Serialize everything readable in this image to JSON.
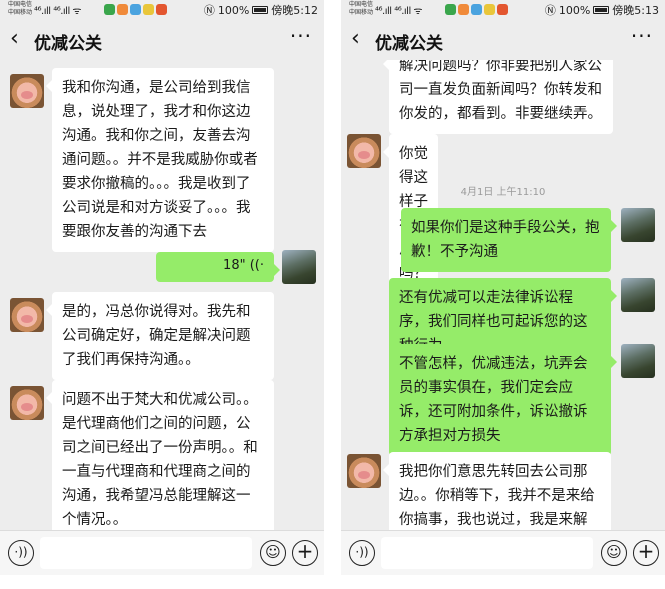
{
  "colors": {
    "chat_background": "#ededed",
    "bubble_incoming": "#ffffff",
    "bubble_outgoing": "#95ec69",
    "timestamp_text": "#9a9a9a"
  },
  "screens": [
    {
      "status": {
        "carrier_1": "中国电信",
        "carrier_2": "中国移动",
        "signal": "⁴⁶.ıll ⁴⁶.ıll ᯤ",
        "battery": "100%",
        "time": "傍晚5:12"
      },
      "header": {
        "back_icon": "chevron-left-icon",
        "title": "优减公关",
        "more": "···"
      },
      "messages": [
        {
          "side": "in",
          "text": "我和你沟通，是公司给到我信息，说处理了，我才和你这边沟通。我和你之间，友善去沟通问题。。并不是我威胁你或者要求你撤稿的。。。我是收到了公司说是和对方谈妥了。。。我要跟你友善的沟通下去"
        },
        {
          "side": "out",
          "kind": "voice",
          "duration": "18\"",
          "icon": "voice-wave-icon"
        },
        {
          "side": "in",
          "text": "是的，冯总你说得对。我先和公司确定好，确定是解决问题了我们再保持沟通。。"
        },
        {
          "side": "in",
          "text": "问题不出于梵大和优减公司。。是代理商他们之间的问题，公司之间已经出了一份声明。。和一直与代理商和代理商之间的沟通，我希望冯总能理解这一个情况。。"
        }
      ],
      "input": {
        "voice_icon": "voice-mode-icon",
        "emoji_icon": "emoji-icon",
        "plus_icon": "plus-icon"
      }
    },
    {
      "status": {
        "carrier_1": "中国电信",
        "carrier_2": "中国移动",
        "signal": "⁴⁶.ıll ⁴⁶.ıll ᯤ",
        "battery": "100%",
        "time": "傍晚5:13"
      },
      "header": {
        "back_icon": "chevron-left-icon",
        "title": "优减公关",
        "more": "···"
      },
      "messages": [
        {
          "side": "in",
          "text": "解决问题吗？你非要把别人家公司一直发负面新闻吗？你转发和你发的，都看到。非要继续弄。"
        },
        {
          "side": "in",
          "text": "你觉得这样子有意思了吗？"
        },
        {
          "kind": "timestamp",
          "text": "4月1日 上午11:10"
        },
        {
          "side": "out",
          "text": "如果你们是这种手段公关，抱歉！不予沟通"
        },
        {
          "side": "out",
          "text": "还有优减可以走法律诉讼程序，我们同样也可起诉您的这种行为"
        },
        {
          "side": "out",
          "text": "不管怎样，优减违法，坑弄会员的事实俱在，我们定会应诉，还可附加条件，诉讼撤诉方承担对方损失"
        },
        {
          "side": "in",
          "text": "我把你们意思先转回去公司那边。。你稍等下，我并不是来给你搞事，我也说过，我是来解决"
        }
      ],
      "input": {
        "voice_icon": "voice-mode-icon",
        "emoji_icon": "emoji-icon",
        "plus_icon": "plus-icon"
      }
    }
  ]
}
